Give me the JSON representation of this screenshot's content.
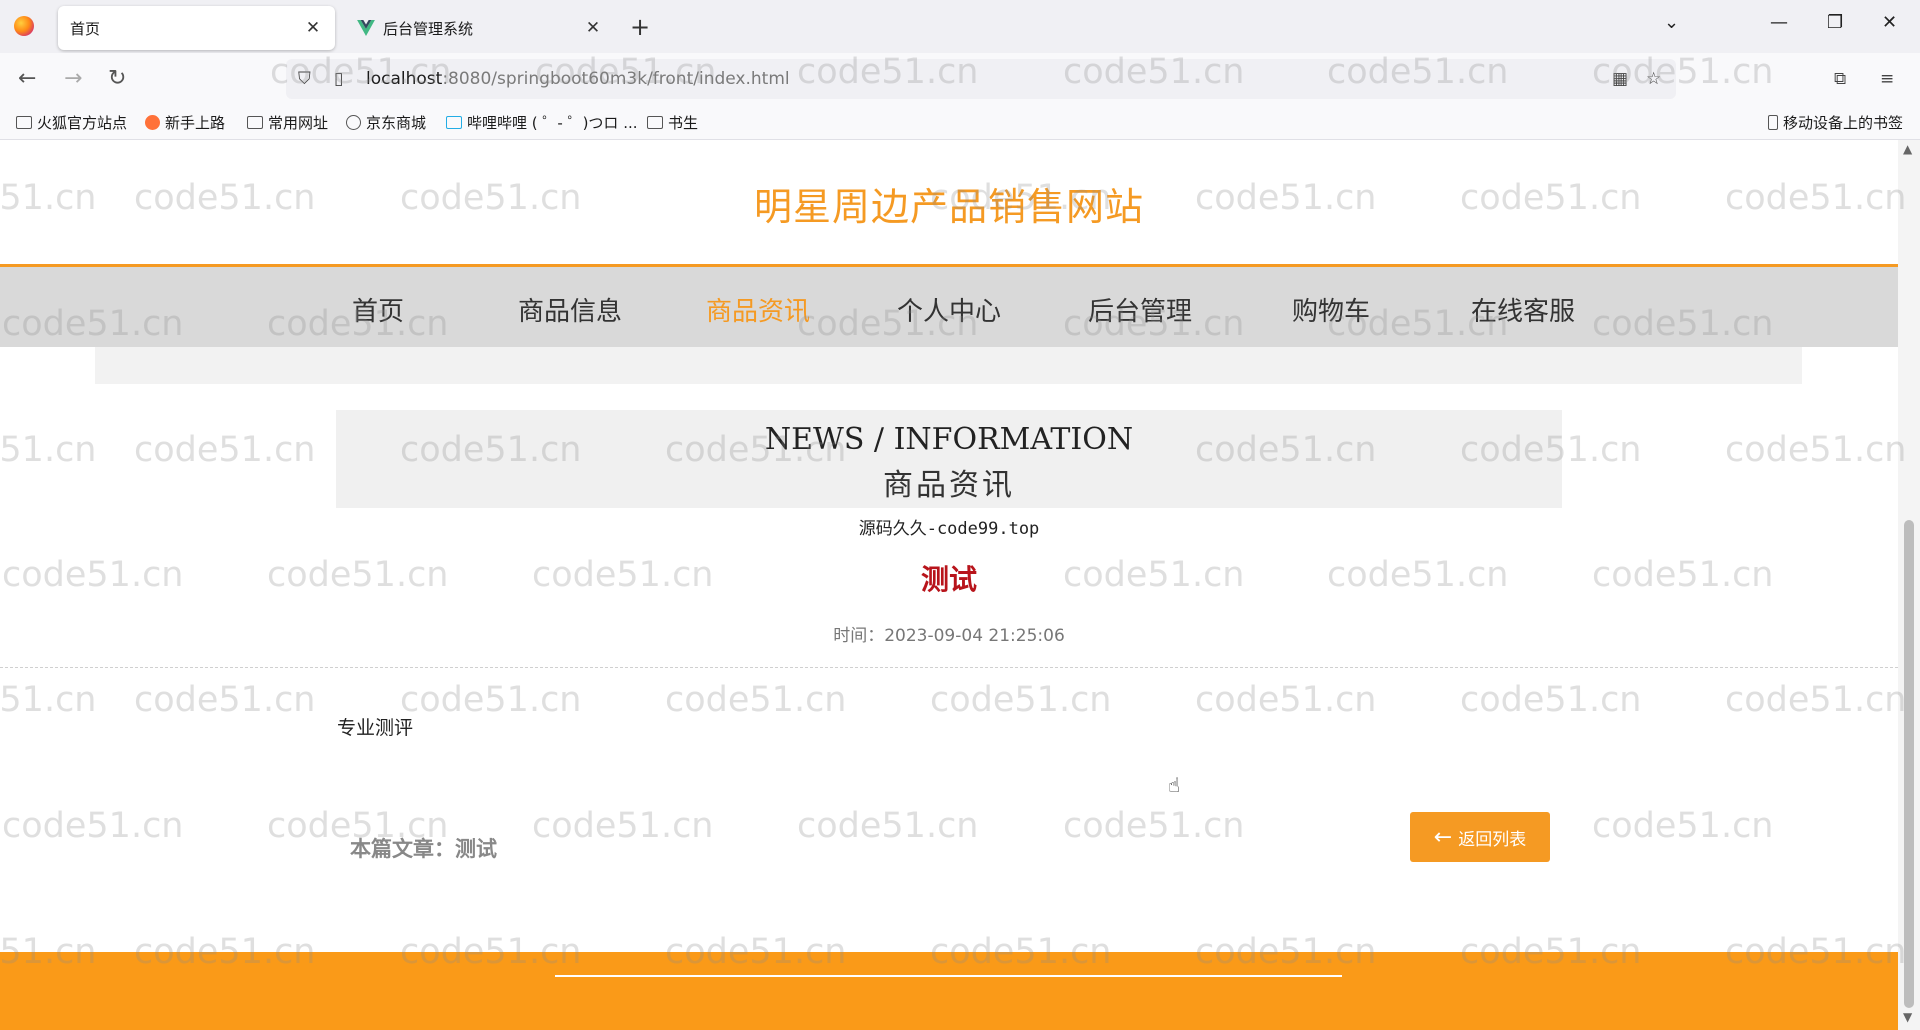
{
  "browser": {
    "tabs": [
      {
        "label": "首页",
        "active": true
      },
      {
        "label": "后台管理系统",
        "active": false
      }
    ],
    "url_host": "localhost",
    "url_rest": ":8080/springboot60m3k/front/index.html",
    "bookmarks": [
      "火狐官方站点",
      "新手上路",
      "常用网址",
      "京东商城",
      "哔哩哔哩 ( ゜- ゜)つロ ...",
      "书生"
    ],
    "mobile_bookmarks": "移动设备上的书签"
  },
  "site": {
    "title": "明星周边产品销售网站",
    "menu": [
      "首页",
      "商品信息",
      "商品资讯",
      "个人中心",
      "后台管理",
      "购物车",
      "在线客服"
    ],
    "active_menu": "商品资讯"
  },
  "section": {
    "title_en": "NEWS / INFORMATION",
    "title_cn": "商品资讯"
  },
  "promo_text": "源码久久-code99.top",
  "article": {
    "title": "测试",
    "time": "时间：2023-09-04 21:25:06",
    "body": "专业测评",
    "current": "本篇文章：测试",
    "back_label": "返回列表"
  },
  "watermark": "code51.cn",
  "colors": {
    "accent": "#f59a23",
    "article_title": "#b8141b",
    "footer": "#fa9a18",
    "menu_bg": "#d9d9d9"
  }
}
